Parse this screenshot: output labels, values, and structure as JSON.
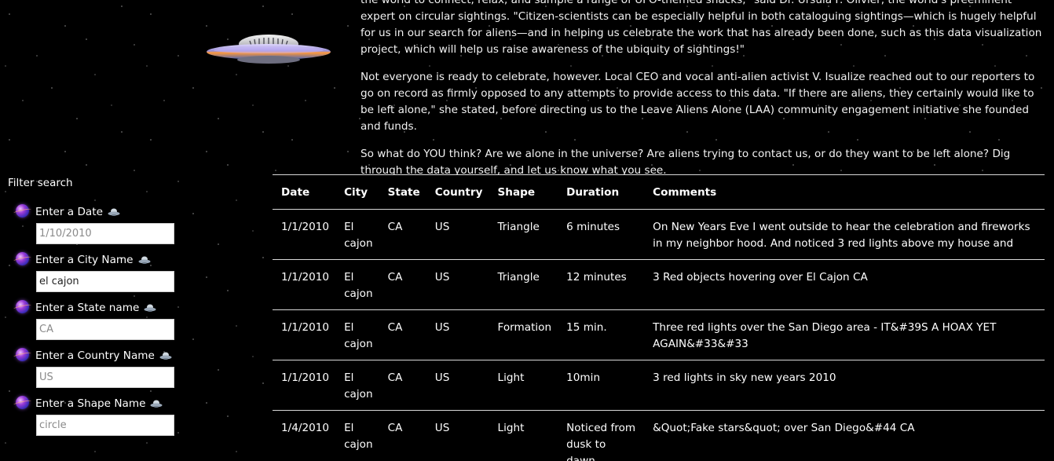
{
  "intro": {
    "paragraph1": "the world to connect, relax, and sample a range of UFO-themed snacks,\" said Dr. Ursula F. Olivier, the world's preeminent expert on circular sightings. \"Citizen-scientists can be especially helpful in both cataloguing sightings—which is hugely helpful for us in our search for aliens—and in helping us celebrate the work that has already been done, such as this data visualization project, which will help us raise awareness of the ubiquity of sightings!\"",
    "paragraph2": "Not everyone is ready to celebrate, however. Local CEO and vocal anti-alien activist V. Isualize reached out to our reporters to go on record as firmly opposed to any attempts to provide access to this data. \"If there are aliens, they certainly would like to be left alone,\" she stated, before directing us to the Leave Aliens Alone (LAA) community engagement initiative she founded and funds.",
    "paragraph3": "So what do YOU think? Are we alone in the universe? Are aliens trying to contact us, or do they want to be left alone? Dig through the data yourself, and let us know what you see."
  },
  "sidebar": {
    "title": "Filter search",
    "filters": [
      {
        "label": "Enter a Date",
        "value": "",
        "placeholder": "1/10/2010"
      },
      {
        "label": "Enter a City Name",
        "value": "el cajon",
        "placeholder": ""
      },
      {
        "label": "Enter a State name",
        "value": "",
        "placeholder": "CA"
      },
      {
        "label": "Enter a Country Name",
        "value": "",
        "placeholder": "US"
      },
      {
        "label": "Enter a Shape Name",
        "value": "",
        "placeholder": "circle"
      }
    ]
  },
  "table": {
    "headers": [
      "Date",
      "City",
      "State",
      "Country",
      "Shape",
      "Duration",
      "Comments"
    ],
    "rows": [
      {
        "date": "1/1/2010",
        "city": "El cajon",
        "state": "CA",
        "country": "US",
        "shape": "Triangle",
        "duration": "6 minutes",
        "comments": "On New Years Eve I went outside to hear the celebration and fireworks in my neighbor hood. And noticed 3 red lights above my house and"
      },
      {
        "date": "1/1/2010",
        "city": "El cajon",
        "state": "CA",
        "country": "US",
        "shape": "Triangle",
        "duration": "12 minutes",
        "comments": "3 Red objects hovering over El Cajon CA"
      },
      {
        "date": "1/1/2010",
        "city": "El cajon",
        "state": "CA",
        "country": "US",
        "shape": "Formation",
        "duration": "15 min.",
        "comments": "Three red lights over the San Diego area - IT&#39S A HOAX YET AGAIN&#33&#33"
      },
      {
        "date": "1/1/2010",
        "city": "El cajon",
        "state": "CA",
        "country": "US",
        "shape": "Light",
        "duration": "10min",
        "comments": "3 red lights in sky new years 2010"
      },
      {
        "date": "1/4/2010",
        "city": "El cajon",
        "state": "CA",
        "country": "US",
        "shape": "Light",
        "duration": "Noticed from dusk to dawn",
        "comments": "&Quot;Fake stars&quot; over San Diego&#44 CA"
      }
    ]
  }
}
